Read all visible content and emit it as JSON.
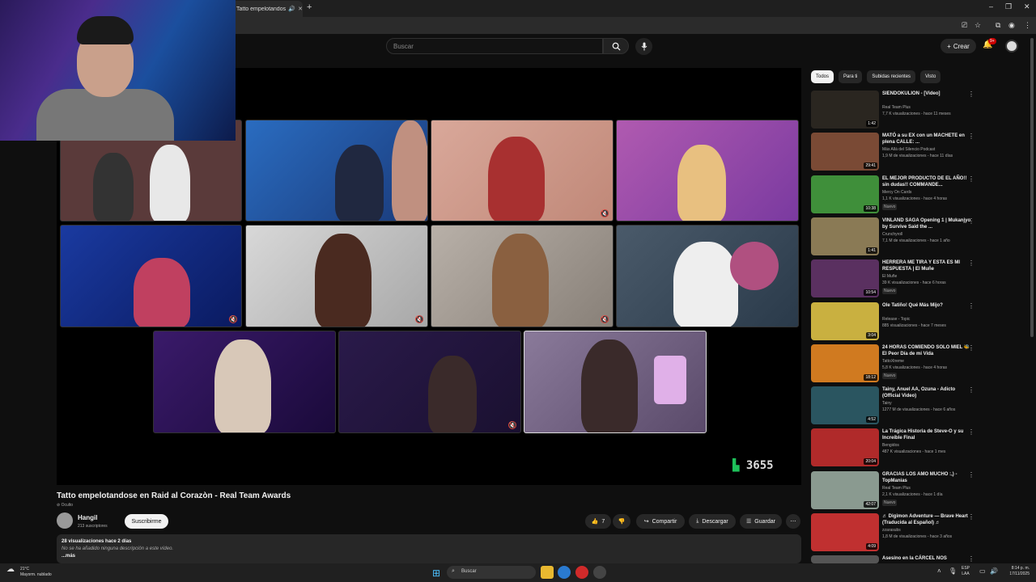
{
  "browser": {
    "tab_title": "Tatto empelotandos",
    "new_tab": "+",
    "minimize": "–",
    "maximize": "❐",
    "close": "✕"
  },
  "header": {
    "search_placeholder": "Buscar",
    "create_label": "Crear",
    "notif_badge": "9+"
  },
  "player": {
    "score_text": "3655"
  },
  "video": {
    "title": "Tatto empelotandose en Raid al Corazòn - Real Team Awards",
    "privacy": "Oculto",
    "channel": "Hangil",
    "subs": "213 suscriptores",
    "subscribe": "Suscribirme",
    "likes": "7",
    "share": "Compartir",
    "download": "Descargar",
    "save": "Guardar",
    "views_date": "28 visualizaciones  hace 2 días",
    "no_desc": "No se ha añadido ninguna descripción a este vídeo.",
    "more": "...más"
  },
  "sidebar": {
    "chips": [
      "Todos",
      "Para ti",
      "Subidas recientes",
      "Visto"
    ],
    "items": [
      {
        "title": "SIENDOKULION - [Video]",
        "channel": "Real Team Plus",
        "meta": "7,7 K visualizaciones - hace 11 meses",
        "duration": "1:42",
        "new": "",
        "thumb_color": "#2a2620"
      },
      {
        "title": "MATÓ a su EX con un MACHETE en plena CALLE: ...",
        "channel": "Más Allá del Silencio Podcast",
        "meta": "1,9 M de visualizaciones - hace 11 días",
        "duration": "29:41",
        "new": "",
        "thumb_color": "#7a4a35"
      },
      {
        "title": "EL MEJOR PRODUCTO DE EL AÑO!! sin dudas!! COMMANDE...",
        "channel": "Mercy On Cards",
        "meta": "1,1 K visualizaciones - hace 4 horas",
        "duration": "10:38",
        "new": "Nuevo",
        "thumb_color": "#3f8f3a"
      },
      {
        "title": "VINLAND SAGA Opening 1 | Mukanjyo by Survive Said the ...",
        "channel": "Crunchyroll",
        "meta": "7,1 M de visualizaciones - hace 1 año",
        "duration": "1:41",
        "new": "",
        "thumb_color": "#8a7a55"
      },
      {
        "title": "HERRERA ME TIRA Y ESTA ES MI RESPUESTA | El Muñe",
        "channel": "El Muñe",
        "meta": "39 K visualizaciones - hace 6 horas",
        "duration": "10:54",
        "new": "Nuevo",
        "thumb_color": "#5a3060"
      },
      {
        "title": "Ole Tatiño! Qué Más Mijo?",
        "channel": "Release - Topic",
        "meta": "885 visualizaciones - hace 7 meses",
        "duration": "3:04",
        "new": "",
        "thumb_color": "#c9b040"
      },
      {
        "title": "24 HORAS COMIENDO SOLO MIEL 🐝El Peor Día de mi Vida",
        "channel": "TattoXtreme",
        "meta": "5,8 K visualizaciones - hace 4 horas",
        "duration": "18:12",
        "new": "Nuevo",
        "thumb_color": "#d07a20"
      },
      {
        "title": "Tainy, Anuel AA, Ozuna - Adicto (Official Video)",
        "channel": "Tainy",
        "meta": "1277 M de visualizaciones - hace 6 años",
        "duration": "4:52",
        "new": "",
        "thumb_color": "#2a5560"
      },
      {
        "title": "La Trágica Historia de Steve-O y su Increíble Final",
        "channel": "Bengidos",
        "meta": "487 K visualizaciones - hace 1 mes",
        "duration": "20:04",
        "new": "",
        "thumb_color": "#b02a2a"
      },
      {
        "title": "GRACIAS LOS AMO MUCHO :,) - TopManias",
        "channel": "Real Team Plus",
        "meta": "2,1 K visualizaciones - hace 1 día",
        "duration": "42:07",
        "new": "Nuevo",
        "thumb_color": "#8a9a90"
      },
      {
        "title": "♬ Digimon Adventure — Brave Heart (Traducida al Español) ♬",
        "channel": "zzarasubs",
        "meta": "1,8 M de visualizaciones - hace 3 años",
        "duration": "4:09",
        "new": "",
        "thumb_color": "#c03030"
      },
      {
        "title": "Asesino en la CÁRCEL NOS",
        "channel": "",
        "meta": "",
        "duration": "",
        "new": "",
        "thumb_color": "#555555"
      }
    ]
  },
  "taskbar": {
    "temp": "21°C",
    "weather": "Mayorm. nublado",
    "search": "Buscar",
    "lang1": "ESP",
    "lang2": "LAA",
    "time": "8:14 p. m.",
    "date": "17/11/2025"
  }
}
